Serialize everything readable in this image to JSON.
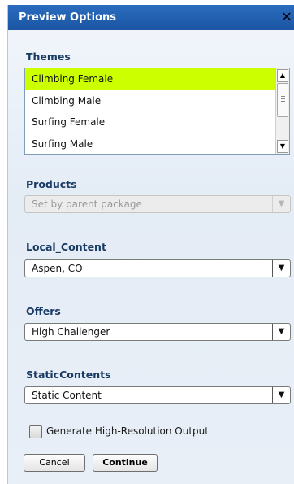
{
  "dialog": {
    "title": "Preview Options"
  },
  "themes": {
    "label": "Themes",
    "items": [
      {
        "label": "Climbing Female",
        "selected": true
      },
      {
        "label": "Climbing Male",
        "selected": false
      },
      {
        "label": "Surfing Female",
        "selected": false
      },
      {
        "label": "Surfing Male",
        "selected": false
      }
    ]
  },
  "products": {
    "label": "Products",
    "value": "Set by parent package",
    "disabled": true
  },
  "local_content": {
    "label": "Local_Content",
    "value": "Aspen, CO"
  },
  "offers": {
    "label": "Offers",
    "value": "High Challenger"
  },
  "static_contents": {
    "label": "StaticContents",
    "value": "Static Content"
  },
  "high_res": {
    "label": "Generate High-Resolution Output",
    "checked": false
  },
  "buttons": {
    "cancel": "Cancel",
    "continue": "Continue"
  },
  "colors": {
    "titlebar": "#1f5fae",
    "selected_item": "#ccff00",
    "section_label": "#183a63"
  },
  "icons": {
    "close": "close-icon",
    "dropdown": "chevron-down-icon"
  }
}
